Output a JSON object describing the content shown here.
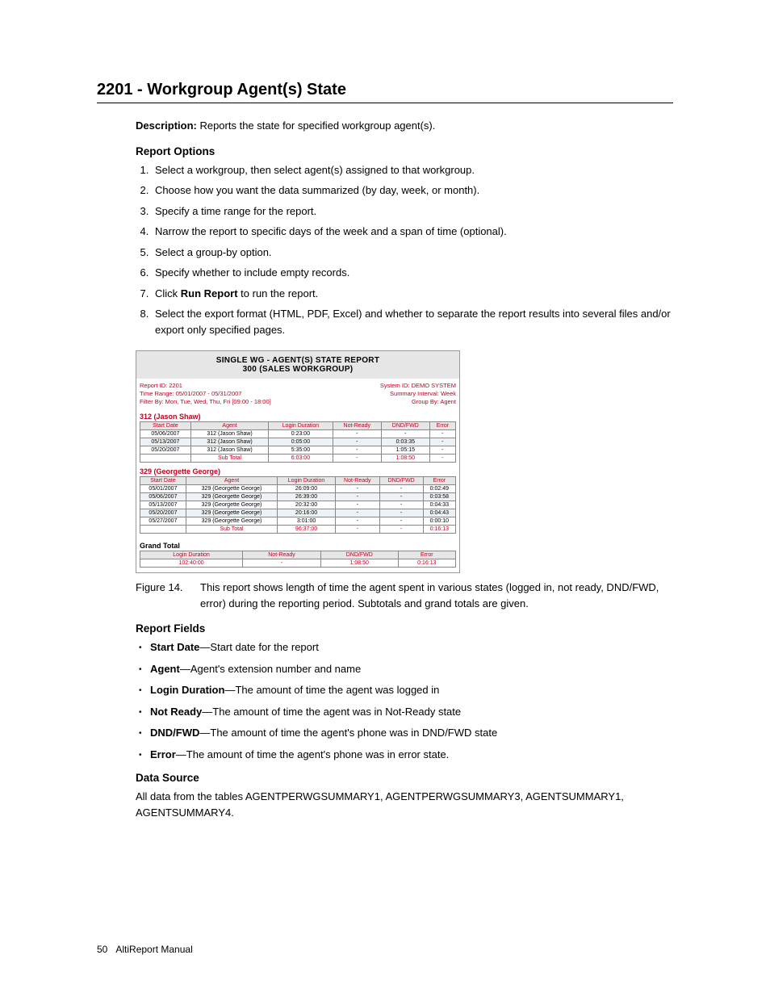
{
  "heading": "2201 - Workgroup Agent(s) State",
  "description_label": "Description:",
  "description_text": " Reports the state for specified workgroup agent(s).",
  "report_options_heading": "Report Options",
  "options": [
    "Select a workgroup, then select agent(s) assigned to that workgroup.",
    "Choose how you want the data summarized (by day, week, or month).",
    "Specify a time range for the report.",
    "Narrow the report to specific days of the week and a span of time (optional).",
    "Select a group-by option.",
    "Specify whether to include empty records.",
    {
      "pre": "Click ",
      "bold": "Run Report",
      "post": " to run the report."
    },
    "Select the export format (HTML, PDF, Excel) and whether to separate the report results into several files and/or export only specified pages."
  ],
  "report": {
    "title_line1": "SINGLE WG - AGENT(S) STATE REPORT",
    "title_line2": "300 (SALES WORKGROUP)",
    "meta_left": [
      "Report ID: 2201",
      "Time Range: 05/01/2007 - 05/31/2007",
      "Filter By: Mon, Tue, Wed, Thu, Fri [09:00 - 18:00]"
    ],
    "meta_right": [
      "System ID: DEMO SYSTEM",
      "Summary Interval: Week",
      "Group By: Agent"
    ],
    "cols": [
      "Start Date",
      "Agent",
      "Login Duration",
      "Not-Ready",
      "DND/FWD",
      "Error"
    ],
    "sections": [
      {
        "name": "312 (Jason Shaw)",
        "rows": [
          [
            "05/06/2007",
            "312 (Jason Shaw)",
            "0:23:00",
            "-",
            "-",
            "-"
          ],
          [
            "05/13/2007",
            "312 (Jason Shaw)",
            "0:05:00",
            "-",
            "0:03:35",
            "-"
          ],
          [
            "05/20/2007",
            "312 (Jason Shaw)",
            "5:35:00",
            "-",
            "1:05:15",
            "-"
          ]
        ],
        "subtotal": [
          "",
          "Sub Total",
          "6:03:00",
          "-",
          "1:08:50",
          "-"
        ]
      },
      {
        "name": "329 (Georgette George)",
        "rows": [
          [
            "05/01/2007",
            "329 (Georgette George)",
            "26:09:00",
            "-",
            "-",
            "0:02:49"
          ],
          [
            "05/06/2007",
            "329 (Georgette George)",
            "26:39:00",
            "-",
            "-",
            "0:03:58"
          ],
          [
            "05/13/2007",
            "329 (Georgette George)",
            "20:32:00",
            "-",
            "-",
            "0:04:33"
          ],
          [
            "05/20/2007",
            "329 (Georgette George)",
            "20:16:00",
            "-",
            "-",
            "0:04:43"
          ],
          [
            "05/27/2007",
            "329 (Georgette George)",
            "3:01:00",
            "-",
            "-",
            "0:00:10"
          ]
        ],
        "subtotal": [
          "",
          "Sub Total",
          "96:37:00",
          "-",
          "-",
          "0:16:13"
        ]
      }
    ],
    "grand_heading": "Grand Total",
    "grand_cols": [
      "Login Duration",
      "Not-Ready",
      "DND/FWD",
      "Error"
    ],
    "grand_row": [
      "102:40:00",
      "-",
      "1:08:50",
      "0:16:13"
    ]
  },
  "figure_label": "Figure 14.",
  "figure_text": "This report shows length of time the agent spent in various states (logged in, not ready, DND/FWD, error) during the reporting period. Subtotals and grand totals are given.",
  "report_fields_heading": "Report Fields",
  "fields": [
    {
      "b": "Start Date",
      "t": "—Start date for the report"
    },
    {
      "b": "Agent",
      "t": "—Agent's extension number and name"
    },
    {
      "b": "Login Duration",
      "t": "—The amount of time the agent was logged in"
    },
    {
      "b": "Not Ready",
      "t": "—The amount of time the agent was in Not-Ready state"
    },
    {
      "b": "DND/FWD",
      "t": "—The amount of time the agent's phone was in DND/FWD state"
    },
    {
      "b": "Error",
      "t": "—The amount of time the agent's phone was in error state."
    }
  ],
  "data_source_heading": "Data Source",
  "data_source_text": "All data from the tables AGENTPERWGSUMMARY1, AGENTPERWGSUMMARY3, AGENTSUMMARY1, AGENTSUMMARY4.",
  "footer_page": "50",
  "footer_text": "AltiReport Manual"
}
